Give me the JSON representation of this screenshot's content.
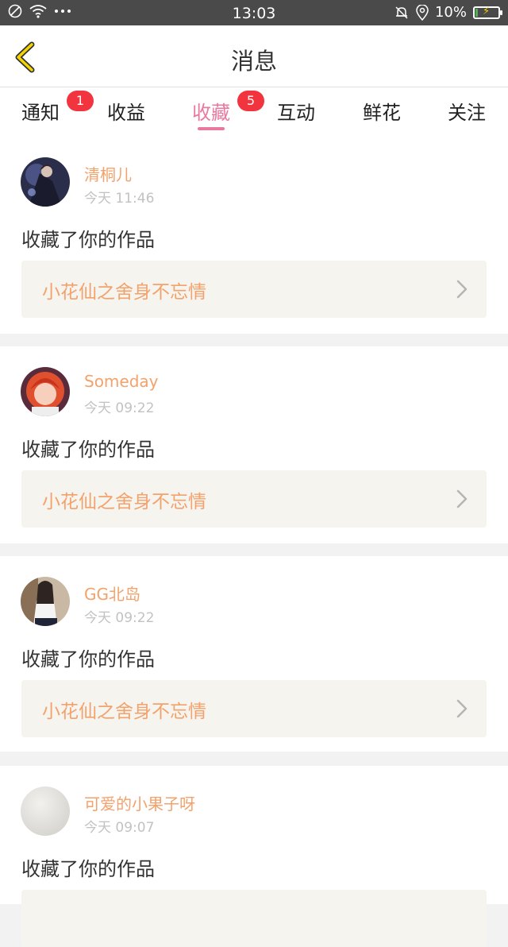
{
  "status_bar": {
    "time": "13:03",
    "battery": "10%"
  },
  "header": {
    "title": "消息"
  },
  "tabs": [
    {
      "label": "通知",
      "badge": "1"
    },
    {
      "label": "收益",
      "badge": ""
    },
    {
      "label": "收藏",
      "badge": "5"
    },
    {
      "label": "互动",
      "badge": ""
    },
    {
      "label": "鲜花",
      "badge": ""
    },
    {
      "label": "关注",
      "badge": ""
    }
  ],
  "active_tab": "收藏",
  "colors": {
    "accent": "#e9799e",
    "name": "#f3a26c",
    "badge": "#f2343e",
    "back_icon": "#f5d300"
  },
  "messages": [
    {
      "user": "清桐儿",
      "time": "今天 11:46",
      "action": "收藏了你的作品",
      "work": "小花仙之舍身不忘情"
    },
    {
      "user": "Someday",
      "time": "今天 09:22",
      "action": "收藏了你的作品",
      "work": "小花仙之舍身不忘情"
    },
    {
      "user": "GG北岛",
      "time": "今天 09:22",
      "action": "收藏了你的作品",
      "work": "小花仙之舍身不忘情"
    },
    {
      "user": "可爱的小果子呀",
      "time": "今天 09:07",
      "action": "收藏了你的作品",
      "work": ""
    }
  ]
}
